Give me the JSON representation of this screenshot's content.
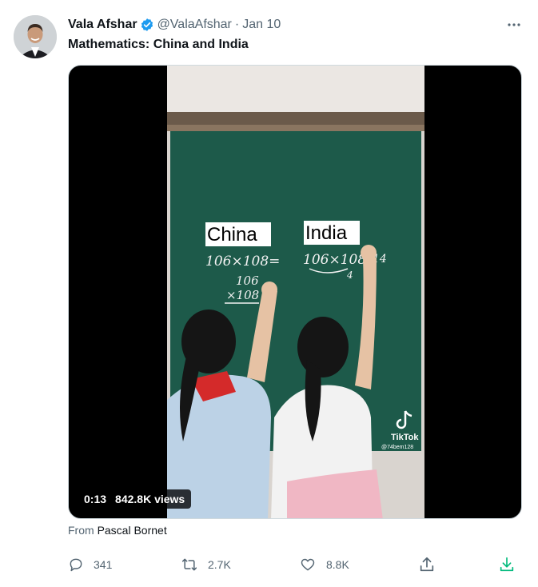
{
  "author": {
    "name": "Vala Afshar",
    "handle": "@ValaAfshar",
    "separator": "·",
    "date": "Jan 10",
    "verified_color": "#1d9bf0"
  },
  "tweet": {
    "text": "Mathematics: China and India"
  },
  "video": {
    "time": "0:13",
    "views": "842.8K views",
    "board_label_left": "China",
    "board_label_right": "India",
    "board_eq_left": "106×108=",
    "board_eq_right": "106×108",
    "board_col_1": "106",
    "board_col_2": "×108",
    "board_right_extra": "114",
    "board_right_small": "4",
    "watermark": "TikTok",
    "watermark_user": "@74bem128"
  },
  "source": {
    "prefix": "From",
    "name": "Pascal Bornet"
  },
  "actions": {
    "replies": "341",
    "retweets": "2.7K",
    "likes": "8.8K"
  },
  "colors": {
    "text_primary": "#0f1419",
    "text_secondary": "#536471",
    "accent": "#1d9bf0",
    "download_icon": "#00ba7c",
    "chalkboard": "#1d5a4a"
  }
}
